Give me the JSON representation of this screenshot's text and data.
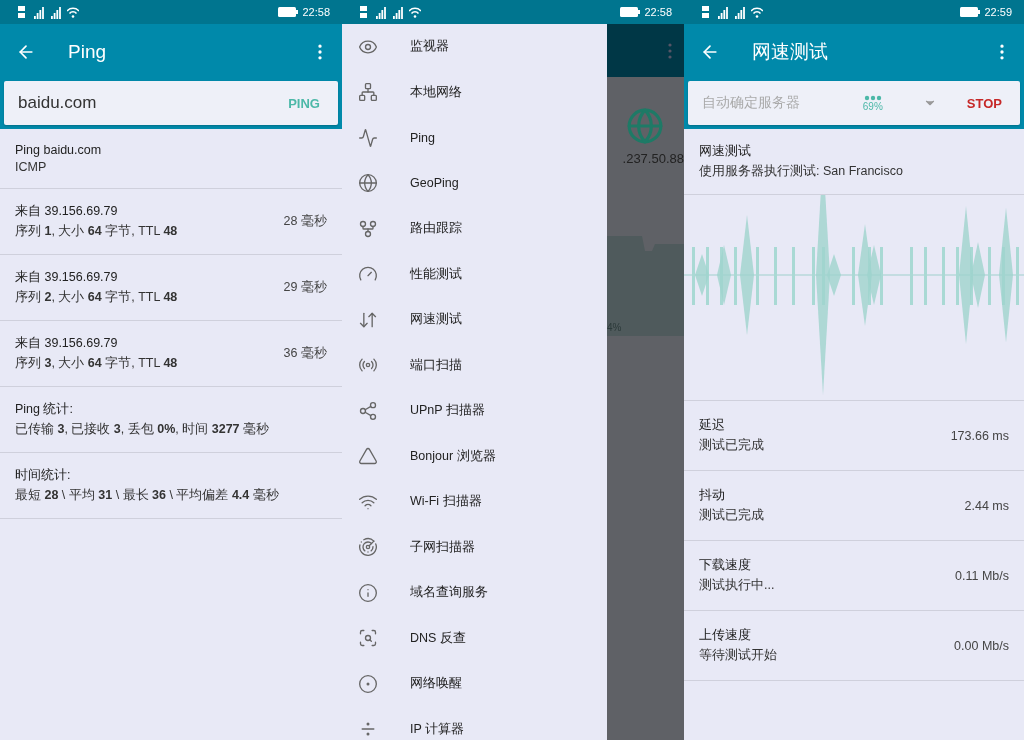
{
  "screens": [
    {
      "status_bar": {
        "time": "22:58"
      },
      "app_bar": {
        "title": "Ping"
      },
      "input": {
        "value": "baidu.com",
        "action": "PING"
      },
      "header": {
        "title": "Ping baidu.com",
        "subtitle": "ICMP"
      },
      "rows": [
        {
          "line1": "来自 39.156.69.79",
          "line2": "序列 **1**, 大小 **64** 字节, TTL **48**",
          "value": "28 毫秒"
        },
        {
          "line1": "来自 39.156.69.79",
          "line2": "序列 **2**, 大小 **64** 字节, TTL **48**",
          "value": "29 毫秒"
        },
        {
          "line1": "来自 39.156.69.79",
          "line2": "序列 **3**, 大小 **64** 字节, TTL **48**",
          "value": "36 毫秒"
        }
      ],
      "stats": [
        {
          "title": "Ping 统计:",
          "text": "已传输 **3**, 已接收 **3**, 丢包 **0%**, 时间 **3277** 毫秒"
        },
        {
          "title": "时间统计:",
          "text": "最短 **28** \\ 平均 **31** \\ 最长 **36** \\ 平均偏差 **4.4** 毫秒"
        }
      ]
    },
    {
      "status_bar": {
        "time": "22:58"
      },
      "background": {
        "address": ".237.50.88",
        "percent": "4%"
      },
      "drawer": {
        "items": [
          {
            "label": "监视器"
          },
          {
            "label": "本地网络"
          },
          {
            "label": "Ping"
          },
          {
            "label": "GeoPing"
          },
          {
            "label": "路由跟踪"
          },
          {
            "label": "性能测试"
          },
          {
            "label": "网速测试"
          },
          {
            "label": "端口扫描"
          },
          {
            "label": "UPnP 扫描器"
          },
          {
            "label": "Bonjour 浏览器"
          },
          {
            "label": "Wi-Fi 扫描器"
          },
          {
            "label": "子网扫描器"
          },
          {
            "label": "域名查询服务"
          },
          {
            "label": "DNS 反查"
          },
          {
            "label": "网络唤醒"
          },
          {
            "label": "IP 计算器"
          }
        ]
      }
    },
    {
      "status_bar": {
        "time": "22:59"
      },
      "app_bar": {
        "title": "网速测试"
      },
      "server": {
        "placeholder": "自动确定服务器",
        "progress": "69%",
        "action": "STOP"
      },
      "header": {
        "title": "网速测试",
        "subtitle": "使用服务器执行测试: San Francisco"
      },
      "results": [
        {
          "title": "延迟",
          "status": "测试已完成",
          "value": "173.66 ms"
        },
        {
          "title": "抖动",
          "status": "测试已完成",
          "value": "2.44 ms"
        },
        {
          "title": "下载速度",
          "status": "测试执行中...",
          "value": "0.11 Mb/s"
        },
        {
          "title": "上传速度",
          "status": "等待测试开始",
          "value": "0.00 Mb/s"
        }
      ]
    }
  ]
}
